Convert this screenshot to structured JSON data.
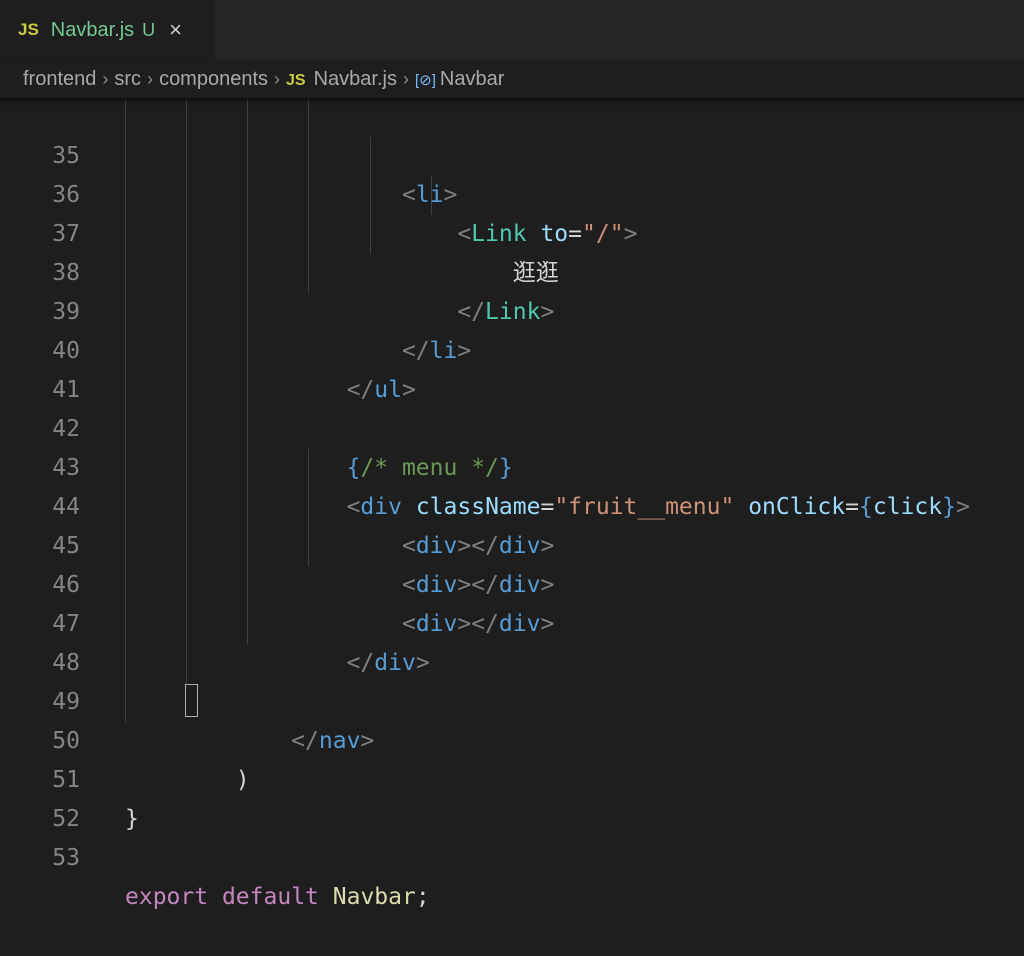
{
  "tab": {
    "lang_badge": "JS",
    "filename": "Navbar.js",
    "status": "U",
    "close": "×"
  },
  "breadcrumb": {
    "items": [
      "frontend",
      "src",
      "components",
      "Navbar.js",
      "Navbar"
    ],
    "js_badge": "JS",
    "symbol_icon": "[⊘]",
    "separator": "›"
  },
  "colors": {
    "background": "#1e1e1e",
    "tab_filename": "#73c991",
    "js_badge": "#cbcb41"
  },
  "editor": {
    "line_numbers": [
      "35",
      "36",
      "37",
      "38",
      "39",
      "40",
      "41",
      "42",
      "43",
      "44",
      "45",
      "46",
      "47",
      "48",
      "49",
      "50",
      "51",
      "52",
      "53"
    ],
    "lines": {
      "l35": {
        "indent": "                    ",
        "open": "<",
        "tag": "li",
        "close": ">"
      },
      "l36": {
        "indent": "                        ",
        "open": "<",
        "comp": "Link",
        "attr": "to",
        "eq": "=",
        "str": "\"/\"",
        "close": ">"
      },
      "l37": {
        "indent": "                            ",
        "text": "逛逛"
      },
      "l38": {
        "indent": "                        ",
        "open": "</",
        "comp": "Link",
        "close": ">"
      },
      "l39": {
        "indent": "                    ",
        "open": "</",
        "tag": "li",
        "close": ">"
      },
      "l40": {
        "indent": "                ",
        "open": "</",
        "tag": "ul",
        "close": ">"
      },
      "l42": {
        "indent": "                ",
        "brace_open": "{",
        "comment": "/* menu */",
        "brace_close": "}"
      },
      "l43": {
        "indent": "                ",
        "open": "<",
        "tag": "div",
        "attr1": "className",
        "eq": "=",
        "str": "\"fruit__menu\"",
        "attr2": "onClick",
        "brace_open": "{",
        "val": "click",
        "brace_close": "}",
        "close": ">"
      },
      "l44": {
        "indent": "                    ",
        "open": "<",
        "tag": "div",
        "mid": "></",
        "tag2": "div",
        "close": ">"
      },
      "l45": {
        "indent": "                    ",
        "open": "<",
        "tag": "div",
        "mid": "></",
        "tag2": "div",
        "close": ">"
      },
      "l46": {
        "indent": "                    ",
        "open": "<",
        "tag": "div",
        "mid": "></",
        "tag2": "div",
        "close": ">"
      },
      "l47": {
        "indent": "                ",
        "open": "</",
        "tag": "div",
        "close": ">"
      },
      "l49": {
        "indent": "            ",
        "open": "</",
        "tag": "nav",
        "close": ">"
      },
      "l50": {
        "indent": "        ",
        "paren": ")"
      },
      "l51": {
        "brace": "}"
      },
      "l53": {
        "kw1": "export",
        "kw2": "default",
        "ident": "Navbar",
        "semi": ";"
      }
    }
  }
}
